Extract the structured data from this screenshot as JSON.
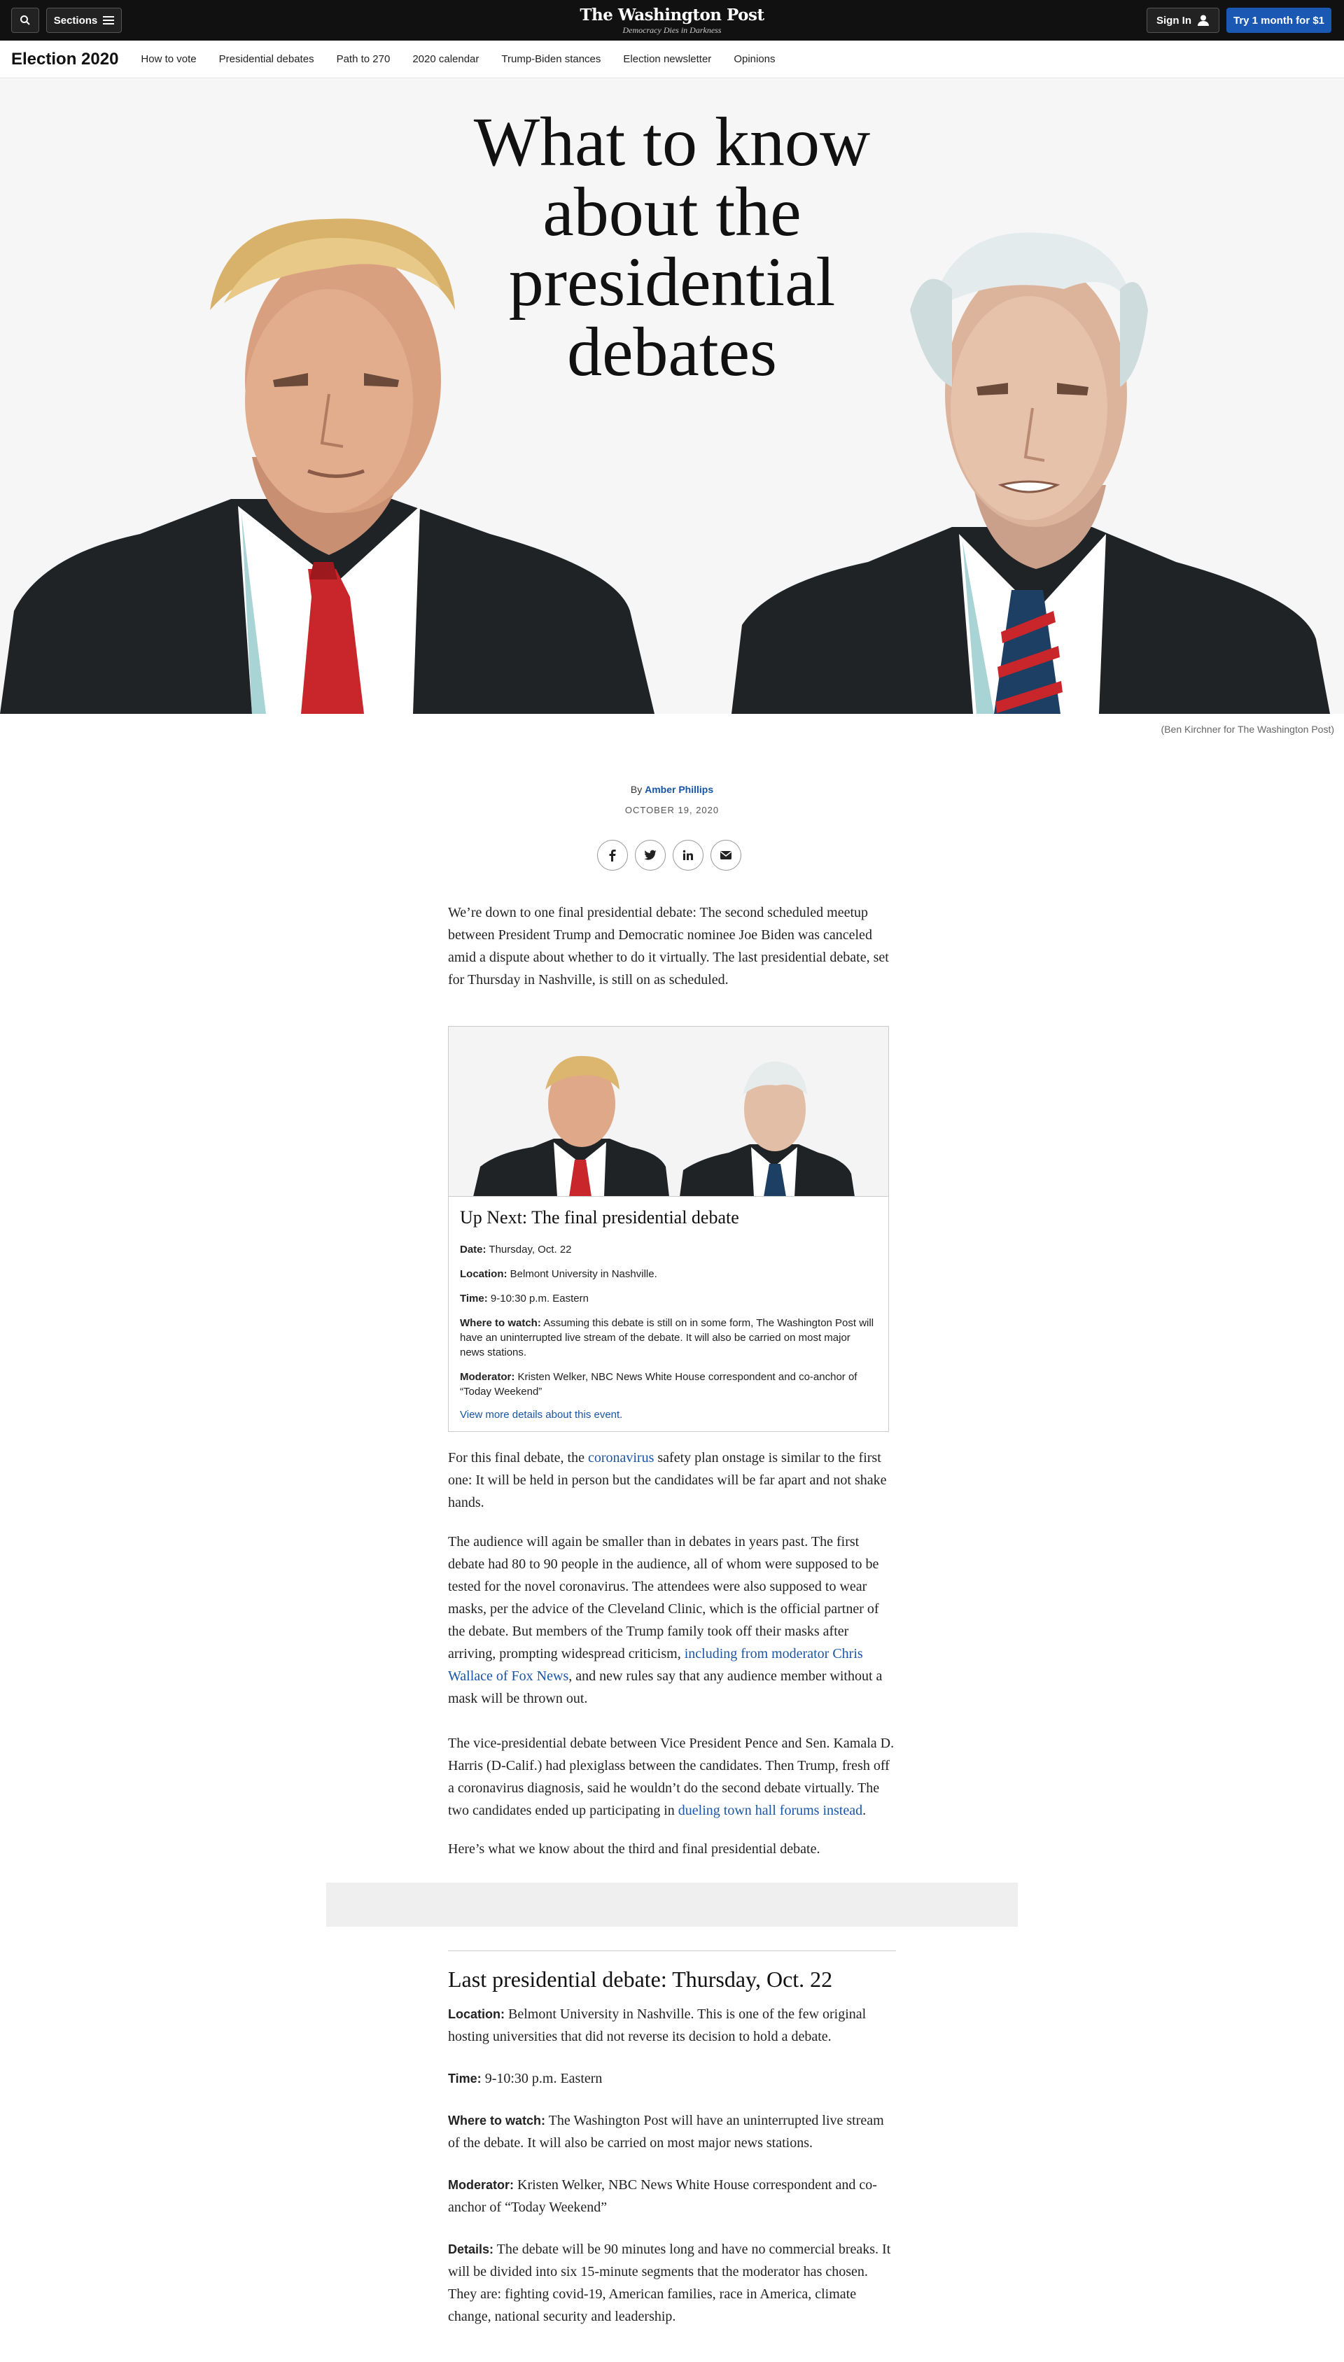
{
  "header": {
    "sections_label": "Sections",
    "logo_name": "The Washington Post",
    "logo_tagline": "Democracy Dies in Darkness",
    "signin_label": "Sign In",
    "subscribe_label": "Try 1 month for $1",
    "colors": {
      "bar": "#111111",
      "subscribe": "#1a58b4",
      "link": "#1955a5"
    }
  },
  "election_nav": {
    "title": "Election 2020",
    "links": [
      "How to vote",
      "Presidential debates",
      "Path to 270",
      "2020 calendar",
      "Trump-Biden stances",
      "Election newsletter",
      "Opinions"
    ]
  },
  "hero": {
    "title_lines": [
      "What to know",
      "about the",
      "presidential",
      "debates"
    ],
    "credit": "(Ben Kirchner for The Washington Post)"
  },
  "byline": {
    "prefix": "By",
    "author": "Amber Phillips",
    "date": "OCTOBER 19, 2020"
  },
  "share": [
    "facebook-icon",
    "twitter-icon",
    "linkedin-icon",
    "email-icon"
  ],
  "intro": "We’re down to one final presidential debate: The second scheduled meetup between President Trump and Democratic nominee Joe Biden was canceled amid a dispute about whether to do it virtually. The last presidential debate, set for Thursday in Nashville, is still on as scheduled.",
  "card": {
    "title": "Up Next: The final presidential debate",
    "rows": [
      {
        "key": "Date:",
        "value": "Thursday, Oct. 22"
      },
      {
        "key": "Location:",
        "value": "Belmont University in Nashville."
      },
      {
        "key": "Time:",
        "value": "9-10:30 p.m. Eastern"
      },
      {
        "key": "Where to watch:",
        "value": "Assuming this debate is still on in some form, The Washington Post will have an uninterrupted live stream of the debate. It will also be carried on most major news stations."
      },
      {
        "key": "Moderator:",
        "value": "Kristen Welker, NBC News White House correspondent and co-anchor of “Today Weekend”"
      }
    ],
    "link": "View more details about this event."
  },
  "p1": {
    "before": "For this final debate, the ",
    "link": "coronavirus",
    "after": " safety plan onstage is similar to the first one: It will be held in person but the candidates will be far apart and not shake hands."
  },
  "p2": {
    "before": "The audience will again be smaller than in debates in years past. The first debate had 80 to 90 people in the audience, all of whom were supposed to be tested for the novel coronavirus. The attendees were also supposed to wear masks, per the advice of the Cleveland Clinic, which is the official partner of the debate. But members of the Trump family took off their masks after arriving, prompting widespread criticism, ",
    "link": "including from moderator Chris Wallace of Fox News",
    "after": ", and new rules say that any audience member without a mask will be thrown out."
  },
  "p3": {
    "before": "The vice-presidential debate between Vice President Pence and Sen. Kamala D. Harris (D-Calif.) had plexiglass between the candidates. Then Trump, fresh off a coronavirus diagnosis, said he wouldn’t do the second debate virtually. The two candidates ended up participating in ",
    "link": "dueling town hall forums instead",
    "after": "."
  },
  "p4": "Here’s what we know about the third and final presidential debate.",
  "details": {
    "heading": "Last presidential debate: Thursday, Oct. 22",
    "rows": [
      {
        "key": "Location:",
        "value": " Belmont University in Nashville. This is one of the few original hosting universities that did not reverse its decision to hold a debate."
      },
      {
        "key": "Time:",
        "value": " 9-10:30 p.m. Eastern"
      },
      {
        "key": "Where to watch:",
        "value": " The Washington Post will have an uninterrupted live stream of the debate. It will also be carried on most major news stations."
      },
      {
        "key": "Moderator:",
        "value": " Kristen Welker, NBC News White House correspondent and co-anchor of “Today Weekend”"
      },
      {
        "key": "Details:",
        "value": " The debate will be 90 minutes long and have no commercial breaks. It will be divided into six 15-minute segments that the moderator has chosen. They are: fighting covid-19, American families, race in America, climate change, national security and leadership."
      }
    ]
  }
}
